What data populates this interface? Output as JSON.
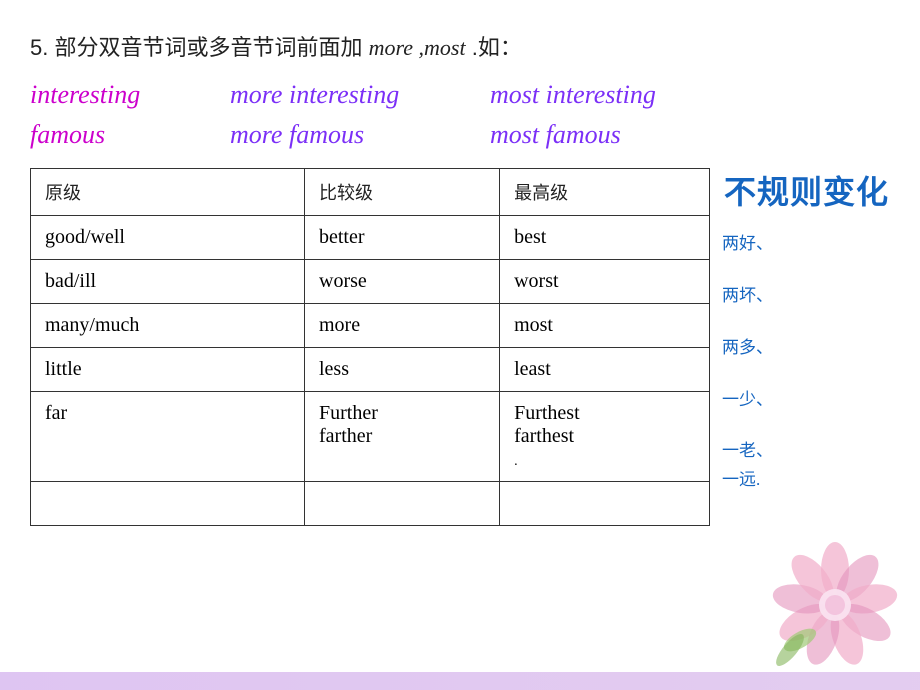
{
  "title": {
    "number": "5.",
    "chinese": "部分双音节词或多音节词前面加",
    "terms": "more ,most",
    "suffix": ".如："
  },
  "examples": [
    {
      "base": "interesting",
      "comparative": "more interesting",
      "superlative": "most interesting"
    },
    {
      "base": "famous",
      "comparative": "more famous",
      "superlative": "most famous"
    }
  ],
  "table": {
    "headers": [
      "原级",
      "比较级",
      "最高级"
    ],
    "rows": [
      {
        "base": "good/well",
        "comparative": "better",
        "superlative": "best",
        "note": "两好、"
      },
      {
        "base": "bad/ill",
        "comparative": "worse",
        "superlative": "worst",
        "note": "两坏、"
      },
      {
        "base": "many/much",
        "comparative": "more",
        "superlative": "most",
        "note": "两多、"
      },
      {
        "base": "little",
        "comparative": "less",
        "superlative": "least",
        "note": "一少、"
      },
      {
        "base": "far",
        "comparative": "Further\nfarther",
        "superlative": "Furthest\nfarthest\n.",
        "note": "一老、\n一远."
      }
    ]
  },
  "irregular_label": "不规则变化",
  "bottom_empty_row": true
}
